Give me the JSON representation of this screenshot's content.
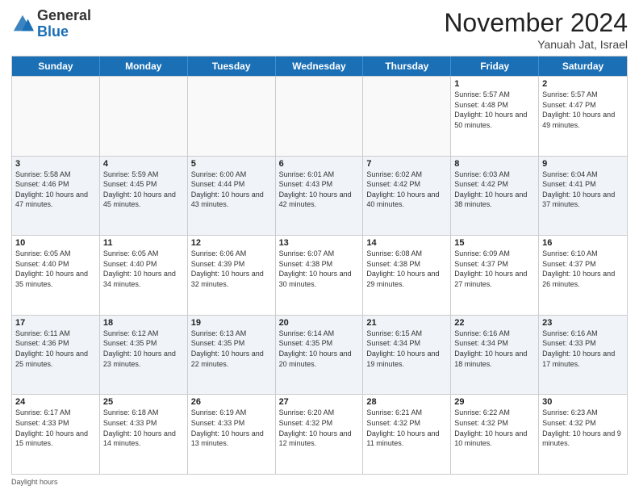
{
  "header": {
    "logo": {
      "general": "General",
      "blue": "Blue"
    },
    "month_title": "November 2024",
    "subtitle": "Yanuah Jat, Israel"
  },
  "weekdays": [
    "Sunday",
    "Monday",
    "Tuesday",
    "Wednesday",
    "Thursday",
    "Friday",
    "Saturday"
  ],
  "weeks": [
    [
      {
        "day": "",
        "info": ""
      },
      {
        "day": "",
        "info": ""
      },
      {
        "day": "",
        "info": ""
      },
      {
        "day": "",
        "info": ""
      },
      {
        "day": "",
        "info": ""
      },
      {
        "day": "1",
        "info": "Sunrise: 5:57 AM\nSunset: 4:48 PM\nDaylight: 10 hours\nand 50 minutes."
      },
      {
        "day": "2",
        "info": "Sunrise: 5:57 AM\nSunset: 4:47 PM\nDaylight: 10 hours\nand 49 minutes."
      }
    ],
    [
      {
        "day": "3",
        "info": "Sunrise: 5:58 AM\nSunset: 4:46 PM\nDaylight: 10 hours\nand 47 minutes."
      },
      {
        "day": "4",
        "info": "Sunrise: 5:59 AM\nSunset: 4:45 PM\nDaylight: 10 hours\nand 45 minutes."
      },
      {
        "day": "5",
        "info": "Sunrise: 6:00 AM\nSunset: 4:44 PM\nDaylight: 10 hours\nand 43 minutes."
      },
      {
        "day": "6",
        "info": "Sunrise: 6:01 AM\nSunset: 4:43 PM\nDaylight: 10 hours\nand 42 minutes."
      },
      {
        "day": "7",
        "info": "Sunrise: 6:02 AM\nSunset: 4:42 PM\nDaylight: 10 hours\nand 40 minutes."
      },
      {
        "day": "8",
        "info": "Sunrise: 6:03 AM\nSunset: 4:42 PM\nDaylight: 10 hours\nand 38 minutes."
      },
      {
        "day": "9",
        "info": "Sunrise: 6:04 AM\nSunset: 4:41 PM\nDaylight: 10 hours\nand 37 minutes."
      }
    ],
    [
      {
        "day": "10",
        "info": "Sunrise: 6:05 AM\nSunset: 4:40 PM\nDaylight: 10 hours\nand 35 minutes."
      },
      {
        "day": "11",
        "info": "Sunrise: 6:05 AM\nSunset: 4:40 PM\nDaylight: 10 hours\nand 34 minutes."
      },
      {
        "day": "12",
        "info": "Sunrise: 6:06 AM\nSunset: 4:39 PM\nDaylight: 10 hours\nand 32 minutes."
      },
      {
        "day": "13",
        "info": "Sunrise: 6:07 AM\nSunset: 4:38 PM\nDaylight: 10 hours\nand 30 minutes."
      },
      {
        "day": "14",
        "info": "Sunrise: 6:08 AM\nSunset: 4:38 PM\nDaylight: 10 hours\nand 29 minutes."
      },
      {
        "day": "15",
        "info": "Sunrise: 6:09 AM\nSunset: 4:37 PM\nDaylight: 10 hours\nand 27 minutes."
      },
      {
        "day": "16",
        "info": "Sunrise: 6:10 AM\nSunset: 4:37 PM\nDaylight: 10 hours\nand 26 minutes."
      }
    ],
    [
      {
        "day": "17",
        "info": "Sunrise: 6:11 AM\nSunset: 4:36 PM\nDaylight: 10 hours\nand 25 minutes."
      },
      {
        "day": "18",
        "info": "Sunrise: 6:12 AM\nSunset: 4:35 PM\nDaylight: 10 hours\nand 23 minutes."
      },
      {
        "day": "19",
        "info": "Sunrise: 6:13 AM\nSunset: 4:35 PM\nDaylight: 10 hours\nand 22 minutes."
      },
      {
        "day": "20",
        "info": "Sunrise: 6:14 AM\nSunset: 4:35 PM\nDaylight: 10 hours\nand 20 minutes."
      },
      {
        "day": "21",
        "info": "Sunrise: 6:15 AM\nSunset: 4:34 PM\nDaylight: 10 hours\nand 19 minutes."
      },
      {
        "day": "22",
        "info": "Sunrise: 6:16 AM\nSunset: 4:34 PM\nDaylight: 10 hours\nand 18 minutes."
      },
      {
        "day": "23",
        "info": "Sunrise: 6:16 AM\nSunset: 4:33 PM\nDaylight: 10 hours\nand 17 minutes."
      }
    ],
    [
      {
        "day": "24",
        "info": "Sunrise: 6:17 AM\nSunset: 4:33 PM\nDaylight: 10 hours\nand 15 minutes."
      },
      {
        "day": "25",
        "info": "Sunrise: 6:18 AM\nSunset: 4:33 PM\nDaylight: 10 hours\nand 14 minutes."
      },
      {
        "day": "26",
        "info": "Sunrise: 6:19 AM\nSunset: 4:33 PM\nDaylight: 10 hours\nand 13 minutes."
      },
      {
        "day": "27",
        "info": "Sunrise: 6:20 AM\nSunset: 4:32 PM\nDaylight: 10 hours\nand 12 minutes."
      },
      {
        "day": "28",
        "info": "Sunrise: 6:21 AM\nSunset: 4:32 PM\nDaylight: 10 hours\nand 11 minutes."
      },
      {
        "day": "29",
        "info": "Sunrise: 6:22 AM\nSunset: 4:32 PM\nDaylight: 10 hours\nand 10 minutes."
      },
      {
        "day": "30",
        "info": "Sunrise: 6:23 AM\nSunset: 4:32 PM\nDaylight: 10 hours\nand 9 minutes."
      }
    ]
  ],
  "footer": {
    "daylight_label": "Daylight hours"
  }
}
